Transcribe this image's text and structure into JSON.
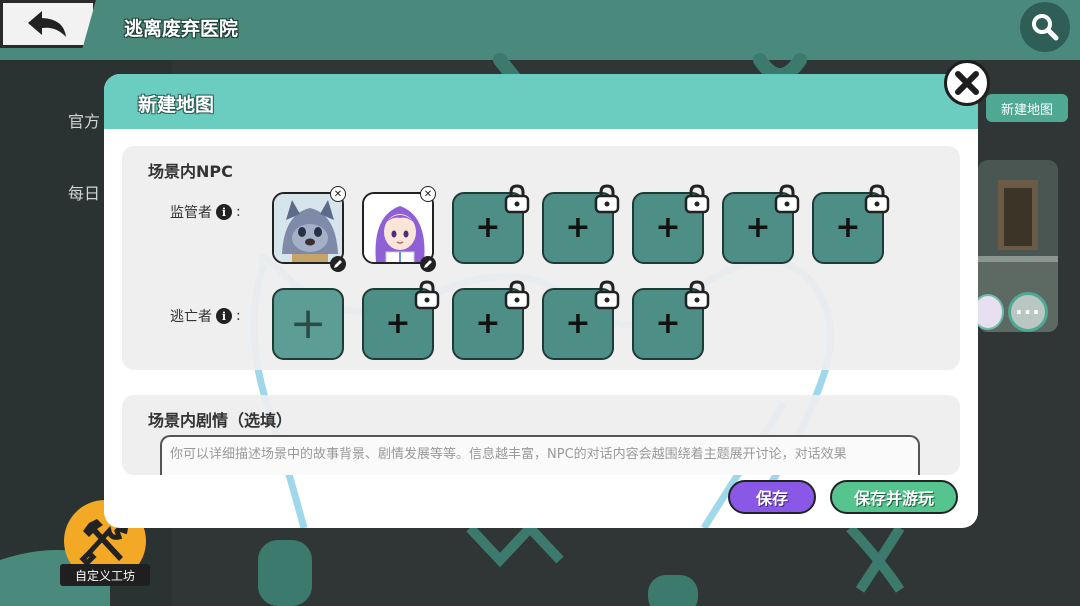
{
  "header": {
    "title": "逃离废弃医院"
  },
  "sidebar": {
    "items": [
      {
        "label": "官方"
      },
      {
        "label": "每日"
      }
    ],
    "workshop_label": "自定义工坊"
  },
  "right_panel": {
    "new_map_label": "新建地图"
  },
  "modal": {
    "title": "新建地图",
    "npc_section": {
      "title": "场景内NPC",
      "supervisor_label": "监管者",
      "escaper_label": "逃亡者",
      "supervisor_slots": [
        {
          "kind": "avatar",
          "avatar": "wolf-character"
        },
        {
          "kind": "avatar",
          "avatar": "purple-hair-girl"
        },
        {
          "kind": "locked"
        },
        {
          "kind": "locked"
        },
        {
          "kind": "locked"
        },
        {
          "kind": "locked"
        },
        {
          "kind": "locked"
        }
      ],
      "escaper_slots": [
        {
          "kind": "open"
        },
        {
          "kind": "locked"
        },
        {
          "kind": "locked"
        },
        {
          "kind": "locked"
        },
        {
          "kind": "locked"
        }
      ]
    },
    "story_section": {
      "title": "场景内剧情（选填）",
      "placeholder": "你可以详细描述场景中的故事背景、剧情发展等等。信息越丰富，NPC的对话内容会越围绕着主题展开讨论，对话效果"
    },
    "buttons": {
      "save": "保存",
      "save_and_play": "保存并游玩"
    }
  },
  "colors": {
    "header_teal": "#6acdc0",
    "slot_teal": "#4d8e86",
    "save_purple": "#8a58e6",
    "save_play_green": "#56c48f"
  }
}
